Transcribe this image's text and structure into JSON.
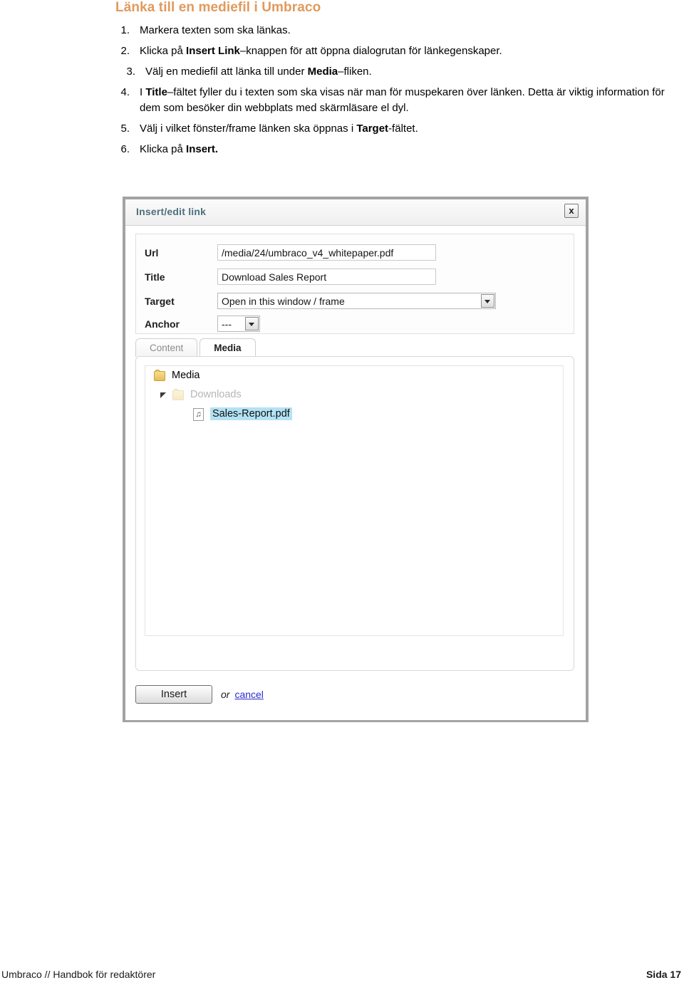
{
  "document": {
    "heading": "Länka till en mediefil i Umbraco",
    "steps": [
      {
        "num": "1.",
        "pre": "Markera texten som ska länkas.",
        "bold": "",
        "post": ""
      },
      {
        "num": "2.",
        "pre": "Klicka på ",
        "bold": "Insert Link",
        "post": "–knappen för att öppna dialogrutan för länkegenskaper."
      },
      {
        "num": "3.",
        "pre": "Välj en mediefil att länka till under ",
        "bold": "Media",
        "post": "–fliken."
      },
      {
        "num": "4.",
        "pre": "I ",
        "bold": "Title",
        "post": "–fältet fyller du i texten som ska visas när man för muspekaren över länken. Detta är viktig information för dem som besöker din webbplats med skärmläsare el dyl."
      },
      {
        "num": "5.",
        "pre": "Välj i vilket fönster/frame länken ska öppnas i ",
        "bold": "Target",
        "post": "-fältet."
      },
      {
        "num": "6.",
        "pre": "Klicka på ",
        "bold": "Insert.",
        "post": ""
      }
    ]
  },
  "dialog": {
    "title": "Insert/edit link",
    "close_label": "x",
    "fields": [
      {
        "label": "Url",
        "value": "/media/24/umbraco_v4_whitepaper.pdf"
      },
      {
        "label": "Title",
        "value": "Download Sales Report"
      },
      {
        "label": "Target",
        "value": "Open in this window / frame"
      },
      {
        "label": "Anchor",
        "value": "---"
      }
    ],
    "tabs": [
      {
        "label": "Content",
        "active": false
      },
      {
        "label": "Media",
        "active": true
      }
    ],
    "tree": [
      {
        "label": "Media",
        "level": 0,
        "icon": "folder-icon",
        "state": "normal"
      },
      {
        "label": "Downloads",
        "level": 1,
        "icon": "folder-icon",
        "state": "muted"
      },
      {
        "label": "Sales-Report.pdf",
        "level": 2,
        "icon": "file-icon",
        "state": "selected"
      }
    ],
    "file_icon_glyph": "♫",
    "actions": {
      "insert_label": "Insert",
      "or_label": "or",
      "cancel_label": "cancel"
    }
  },
  "footer": {
    "left": "Umbraco // Handbok för redaktörer",
    "right": "Sida 17"
  },
  "colors": {
    "heading": "#e09a5c",
    "dialog_title": "#4d6f7c",
    "selection": "#b3e2f4",
    "link": "#2a2ad0"
  }
}
